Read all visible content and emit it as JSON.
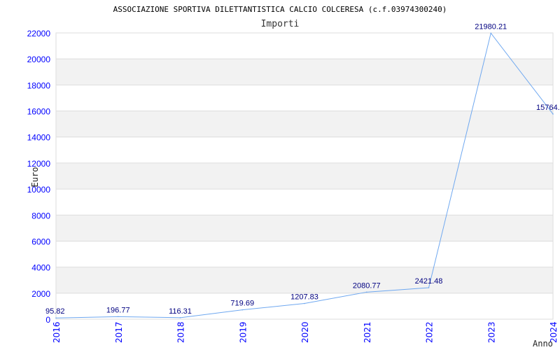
{
  "chart_data": {
    "type": "line",
    "title": "ASSOCIAZIONE SPORTIVA DILETTANTISTICA CALCIO COLCERESA (c.f.03974300240)",
    "subtitle": "Importi",
    "xlabel": "Anno",
    "ylabel": "Euro",
    "categories": [
      "2016",
      "2017",
      "2018",
      "2019",
      "2020",
      "2021",
      "2022",
      "2023",
      "2024"
    ],
    "values": [
      95.82,
      196.77,
      116.31,
      719.69,
      1207.83,
      2080.77,
      2421.48,
      21980.21,
      15764
    ],
    "data_labels": [
      "95.82",
      "196.77",
      "116.31",
      "719.69",
      "1207.83",
      "2080.77",
      "2421.48",
      "21980.21",
      "15764."
    ],
    "ylim": [
      0,
      22000
    ],
    "yticks": [
      "0",
      "2000",
      "4000",
      "6000",
      "8000",
      "10000",
      "12000",
      "14000",
      "16000",
      "18000",
      "20000",
      "22000"
    ],
    "grid": true,
    "colors": {
      "line": "#6fa8f0",
      "axis_text": "#0000ff",
      "label_text": "#000080",
      "band": "#f2f2f2",
      "grid": "#dddddd"
    }
  }
}
